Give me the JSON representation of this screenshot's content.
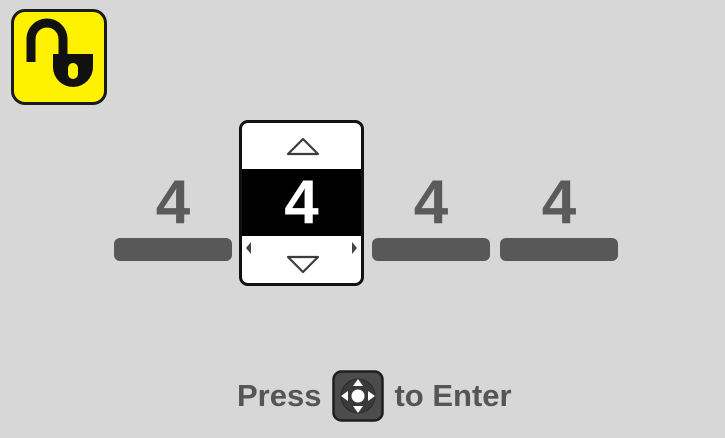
{
  "lock_icon": "unlocked-padlock-icon",
  "accent_color": "#fff200",
  "code": {
    "digits": [
      {
        "value": "4",
        "selected": false
      },
      {
        "value": "4",
        "selected": true
      },
      {
        "value": "4",
        "selected": false
      },
      {
        "value": "4",
        "selected": false
      }
    ],
    "increase_icon": "triangle-up-icon",
    "decrease_icon": "triangle-down-icon"
  },
  "prompt": {
    "prefix": "Press",
    "icon": "dpad-enter-icon",
    "suffix": "to Enter"
  }
}
